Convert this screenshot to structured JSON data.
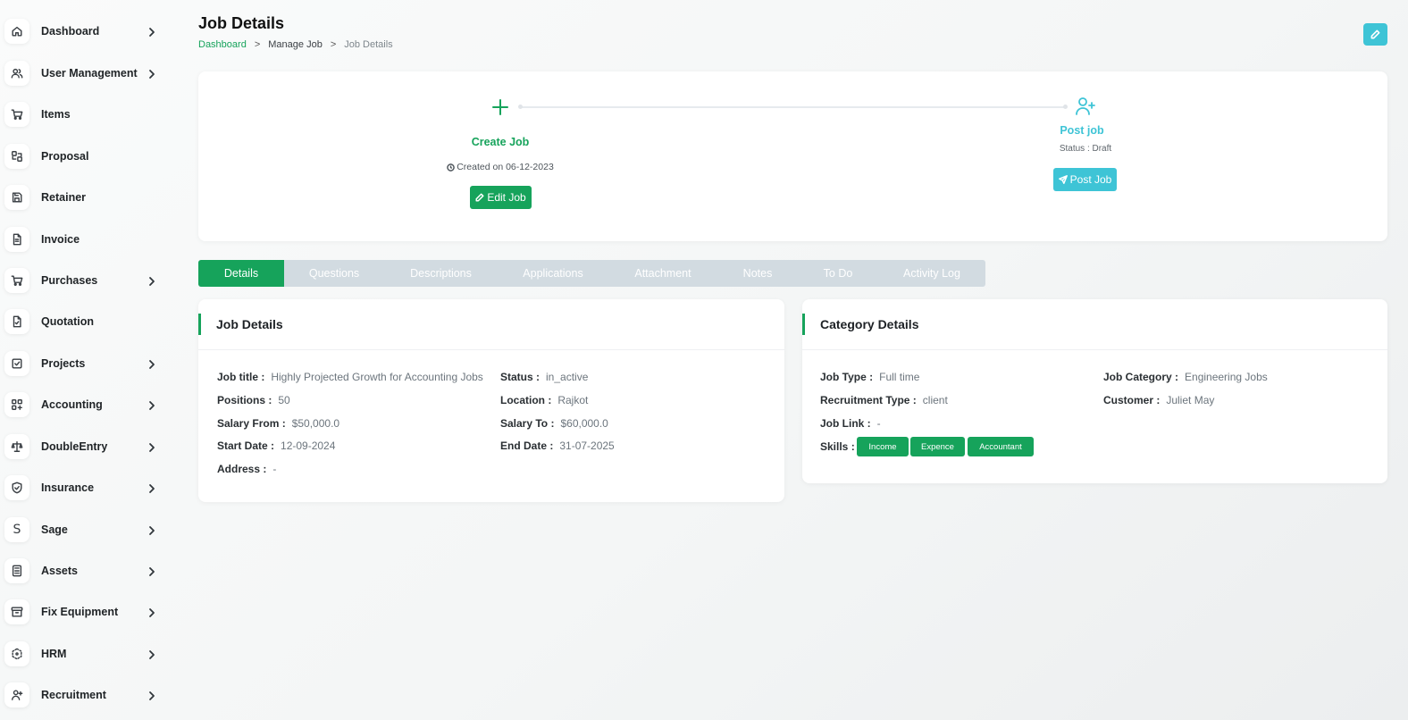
{
  "sidebar": {
    "items": [
      {
        "label": "Dashboard",
        "icon": "home-icon",
        "has_submenu": true
      },
      {
        "label": "User Management",
        "icon": "users-icon",
        "has_submenu": true
      },
      {
        "label": "Items",
        "icon": "cart-icon",
        "has_submenu": false
      },
      {
        "label": "Proposal",
        "icon": "proposal-icon",
        "has_submenu": false
      },
      {
        "label": "Retainer",
        "icon": "save-icon",
        "has_submenu": false
      },
      {
        "label": "Invoice",
        "icon": "file-invoice-icon",
        "has_submenu": false
      },
      {
        "label": "Purchases",
        "icon": "cart-icon",
        "has_submenu": true
      },
      {
        "label": "Quotation",
        "icon": "file-check-icon",
        "has_submenu": false
      },
      {
        "label": "Projects",
        "icon": "checkbox-icon",
        "has_submenu": true
      },
      {
        "label": "Accounting",
        "icon": "grid-plus-icon",
        "has_submenu": true
      },
      {
        "label": "DoubleEntry",
        "icon": "scale-icon",
        "has_submenu": true
      },
      {
        "label": "Insurance",
        "icon": "shield-check-icon",
        "has_submenu": true
      },
      {
        "label": "Sage",
        "icon": "letter-s-icon",
        "glyph": "S",
        "has_submenu": true
      },
      {
        "label": "Assets",
        "icon": "calculator-icon",
        "has_submenu": true
      },
      {
        "label": "Fix Equipment",
        "icon": "archive-icon",
        "has_submenu": true
      },
      {
        "label": "HRM",
        "icon": "hexagon-icon",
        "has_submenu": true
      },
      {
        "label": "Recruitment",
        "icon": "user-plus-icon",
        "has_submenu": true
      }
    ]
  },
  "header": {
    "title": "Job Details",
    "breadcrumb": [
      "Dashboard",
      "Manage Job",
      "Job Details"
    ],
    "breadcrumb_separator": ">"
  },
  "progress": {
    "step1": {
      "label": "Create Job",
      "date": "Created on 06-12-2023",
      "button": "Edit Job"
    },
    "step2": {
      "label": "Post job",
      "status": "Status : Draft",
      "button": "Post Job"
    }
  },
  "tabs": [
    "Details",
    "Questions",
    "Descriptions",
    "Applications",
    "Attachment",
    "Notes",
    "To Do",
    "Activity Log"
  ],
  "active_tab": "Details",
  "job_details": {
    "title": "Job Details",
    "left": [
      {
        "key": "Job title :",
        "value": "Highly Projected Growth for Accounting Jobs"
      },
      {
        "key": "Positions :",
        "value": "50"
      },
      {
        "key": "Salary From :",
        "value": "$50,000.0"
      },
      {
        "key": "Start Date :",
        "value": "12-09-2024"
      },
      {
        "key": "Address :",
        "value": "-"
      }
    ],
    "right": [
      {
        "key": "Status :",
        "value": "in_active"
      },
      {
        "key": "Location :",
        "value": "Rajkot"
      },
      {
        "key": "Salary To :",
        "value": "$60,000.0"
      },
      {
        "key": "End Date :",
        "value": "31-07-2025"
      }
    ]
  },
  "category_details": {
    "title": "Category Details",
    "left": [
      {
        "key": "Job Type :",
        "value": "Full time"
      },
      {
        "key": "Recruitment Type :",
        "value": "client"
      },
      {
        "key": "Job Link :",
        "value": "-"
      }
    ],
    "right": [
      {
        "key": "Job Category :",
        "value": "Engineering Jobs"
      },
      {
        "key": "Customer :",
        "value": "Juliet May"
      }
    ],
    "skills_label": "Skills :",
    "skills": [
      "Income",
      "Expence",
      "Accountant"
    ]
  },
  "colors": {
    "primary": "#16a35b",
    "info": "#3ec4d6",
    "tab_bg": "#d2dbe1"
  }
}
